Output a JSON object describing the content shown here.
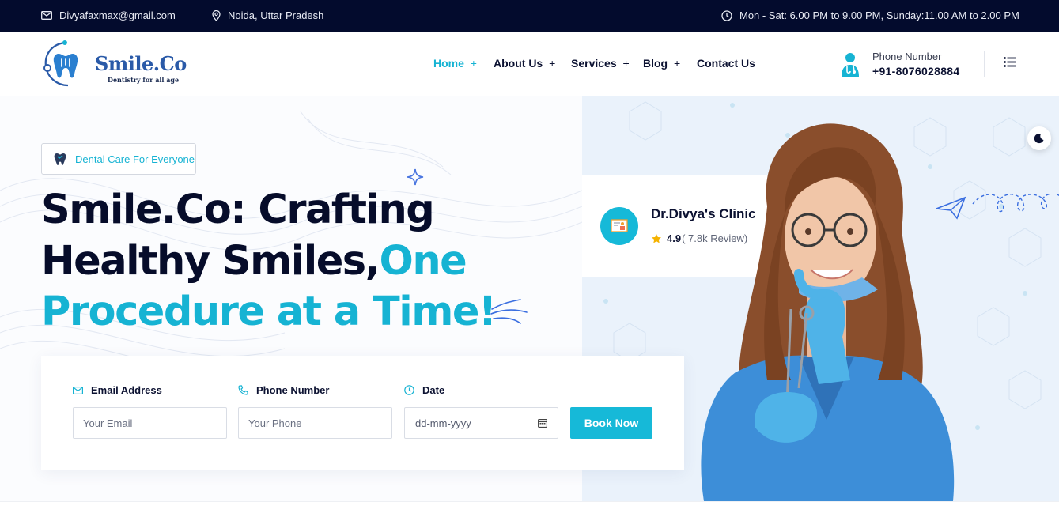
{
  "topbar": {
    "email": "Divyafaxmax@gmail.com",
    "location": "Noida, Uttar Pradesh",
    "hours": "Mon - Sat: 6.00 PM to 9.00 PM, Sunday:11.00 AM to 2.00 PM"
  },
  "logo": {
    "name": "Smile.Co",
    "tagline": "Dentistry for all age"
  },
  "nav": [
    {
      "label": "Home",
      "suffix": "+"
    },
    {
      "label": "About Us",
      "suffix": "+"
    },
    {
      "label": "Services",
      "suffix": "+"
    },
    {
      "label": "Blog",
      "suffix": "+"
    },
    {
      "label": "Contact Us",
      "suffix": ""
    }
  ],
  "contact": {
    "label": "Phone Number",
    "number": "+91-8076028884"
  },
  "hero": {
    "badge": "Dental Care For Everyone",
    "title_line1": "Smile.Co: Crafting",
    "title_line2": "Healthy Smiles,",
    "title_line2_accent": "One",
    "title_line3_accent": "Procedure at a Time!"
  },
  "form": {
    "email_label": "Email Address",
    "email_placeholder": "Your Email",
    "phone_label": "Phone Number",
    "phone_placeholder": "Your Phone",
    "date_label": "Date",
    "date_placeholder": "dd-mm-yyyy",
    "submit": "Book Now"
  },
  "clinic": {
    "name": "Dr.Divya's Clinic",
    "rating": "4.9",
    "reviews": "( 7.8k Review)"
  },
  "colors": {
    "accent": "#16b3d3",
    "navy": "#030b2d",
    "heading": "#060c2a",
    "star": "#f5b301"
  },
  "icons": [
    "mail-icon",
    "location-pin-icon",
    "clock-icon",
    "doctor-icon",
    "menu-icon",
    "tooth-icon",
    "sparkle-icon",
    "phone-icon",
    "calendar-icon",
    "certificate-icon",
    "star-icon",
    "paper-plane-icon",
    "moon-icon"
  ]
}
